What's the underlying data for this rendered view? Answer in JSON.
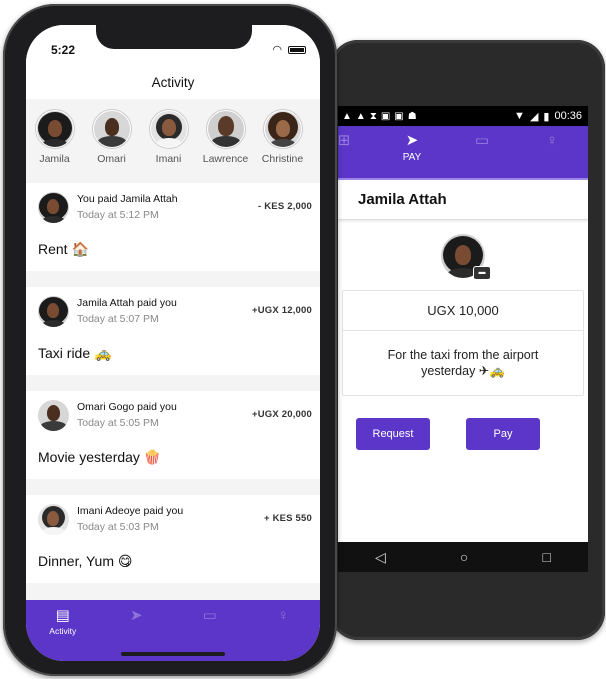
{
  "iphone": {
    "status_time": "5:22",
    "title": "Activity",
    "friends": [
      {
        "name": "Jamila",
        "avatar": "woman-curly-hair"
      },
      {
        "name": "Omari",
        "avatar": "man-suit"
      },
      {
        "name": "Imani",
        "avatar": "woman-glasses"
      },
      {
        "name": "Lawrence",
        "avatar": "man-bald"
      },
      {
        "name": "Christine",
        "avatar": "woman-afro"
      }
    ],
    "transactions": [
      {
        "description": "You paid Jamila Attah",
        "time": "Today at 5:12 PM",
        "amount": "- KES 2,000",
        "memo": "Rent 🏠",
        "avatar": "woman-curly-hair"
      },
      {
        "description": "Jamila Attah paid you",
        "time": "Today at 5:07 PM",
        "amount": "+UGX 12,000",
        "memo": "Taxi ride 🚕",
        "avatar": "woman-curly-hair"
      },
      {
        "description": "Omari Gogo paid you",
        "time": "Today at 5:05 PM",
        "amount": "+UGX 20,000",
        "memo": "Movie yesterday 🍿",
        "avatar": "man-suit"
      },
      {
        "description": "Imani Adeoye paid you",
        "time": "Today at 5:03 PM",
        "amount": "+ KES 550",
        "memo": "Dinner, Yum 😋",
        "avatar": "woman-glasses"
      }
    ],
    "tabbar": [
      {
        "label": "Activity",
        "icon": "activity-icon",
        "active": true
      },
      {
        "label": "",
        "icon": "send-icon",
        "active": false
      },
      {
        "label": "",
        "icon": "card-icon",
        "active": false
      },
      {
        "label": "",
        "icon": "profile-icon",
        "active": false
      }
    ]
  },
  "android": {
    "status_time": "00:36",
    "tabs": [
      {
        "label": "",
        "icon": "grid-icon",
        "active": false
      },
      {
        "label": "PAY",
        "icon": "send-icon",
        "active": true
      },
      {
        "label": "",
        "icon": "card-icon",
        "active": false
      },
      {
        "label": "",
        "icon": "profile-icon",
        "active": false
      }
    ],
    "recipient_name": "Jamila Attah",
    "amount": "UGX 10,000",
    "note": "For the taxi from the airport yesterday ✈🚕",
    "request_label": "Request",
    "pay_label": "Pay"
  },
  "colors": {
    "brand_purple": "#5b36c9",
    "feed_background": "#f4f4f4"
  }
}
